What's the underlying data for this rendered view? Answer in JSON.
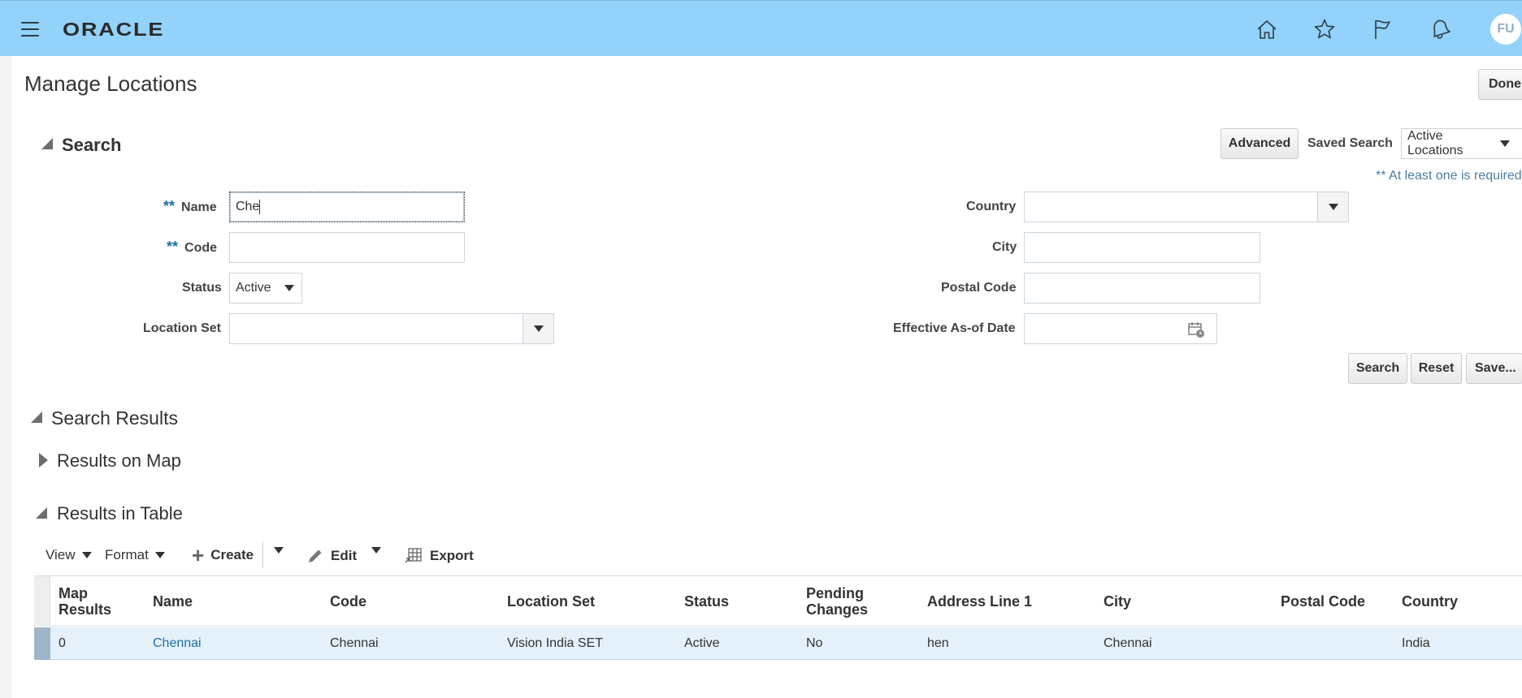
{
  "header": {
    "logo_text": "ORACLE",
    "icons": [
      "home-icon",
      "favorites-star-icon",
      "watchlist-flag-icon",
      "notifications-bell-icon"
    ],
    "avatar_initials": "FU",
    "background_color": "#92d2fb"
  },
  "page": {
    "title": "Manage Locations",
    "done_label": "Done"
  },
  "search": {
    "title": "Search",
    "advanced_label": "Advanced",
    "saved_search_label": "Saved Search",
    "saved_search_value": "Active Locations",
    "required_hint": "** At least one is required",
    "fields": {
      "name": {
        "label": "Name",
        "required_marker": "**",
        "value": "Che"
      },
      "code": {
        "label": "Code",
        "required_marker": "**",
        "value": ""
      },
      "status": {
        "label": "Status",
        "value": "Active"
      },
      "location_set": {
        "label": "Location Set",
        "value": ""
      },
      "country": {
        "label": "Country",
        "value": ""
      },
      "city": {
        "label": "City",
        "value": ""
      },
      "postal_code": {
        "label": "Postal Code",
        "value": ""
      },
      "effective_date": {
        "label": "Effective As-of Date",
        "value": ""
      }
    },
    "buttons": {
      "search": "Search",
      "reset": "Reset",
      "save": "Save..."
    }
  },
  "results": {
    "title": "Search Results",
    "map_section": "Results on Map",
    "table_section": "Results in Table",
    "toolbar": {
      "view": "View",
      "format": "Format",
      "create": "Create",
      "edit": "Edit",
      "export": "Export"
    },
    "columns": [
      "Map Results",
      "Name",
      "Code",
      "Location Set",
      "Status",
      "Pending Changes",
      "Address Line 1",
      "City",
      "Postal Code",
      "Country"
    ],
    "rows": [
      {
        "map_results": "0",
        "name": "Chennai",
        "code": "Chennai",
        "location_set": "Vision India SET",
        "status": "Active",
        "pending_changes": "No",
        "address_line_1": "hen",
        "city": "Chennai",
        "postal_code": "",
        "country": "India"
      }
    ]
  }
}
